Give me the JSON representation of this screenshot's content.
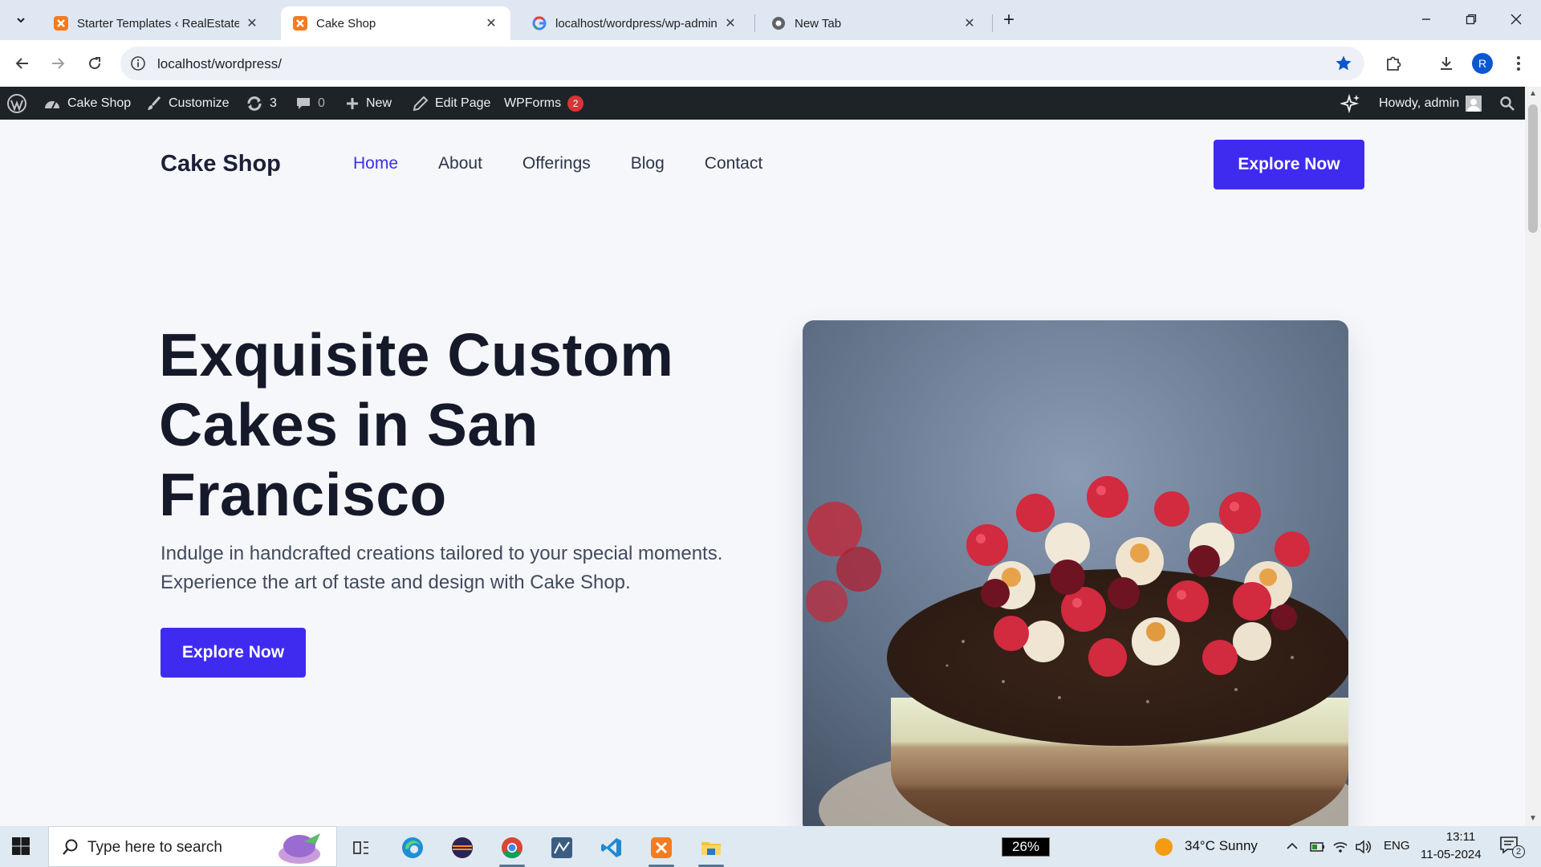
{
  "browser": {
    "tabs": [
      {
        "title": "Starter Templates ‹ RealEstate-E",
        "active": false
      },
      {
        "title": "Cake Shop",
        "active": true
      },
      {
        "title": "localhost/wordpress/wp-admin",
        "active": false
      },
      {
        "title": "New Tab",
        "active": false
      }
    ],
    "url": "localhost/wordpress/",
    "profile_initial": "R"
  },
  "admin_bar": {
    "site_name": "Cake Shop",
    "customize": "Customize",
    "updates_count": "3",
    "comments_count": "0",
    "new": "New",
    "edit_page": "Edit Page",
    "wpforms": "WPForms",
    "wpforms_badge": "2",
    "howdy": "Howdy, admin"
  },
  "site": {
    "title": "Cake Shop",
    "nav": [
      {
        "label": "Home",
        "current": true
      },
      {
        "label": "About",
        "current": false
      },
      {
        "label": "Offerings",
        "current": false
      },
      {
        "label": "Blog",
        "current": false
      },
      {
        "label": "Contact",
        "current": false
      }
    ],
    "header_cta": "Explore Now",
    "hero": {
      "title": "Exquisite Custom Cakes in San Francisco",
      "text": "Indulge in handcrafted creations tailored to your special moments. Experience the art of taste and design with Cake Shop.",
      "cta": "Explore Now"
    },
    "accent_color": "#3f2bf0"
  },
  "taskbar": {
    "search_placeholder": "Type here to search",
    "battery": "26%",
    "weather": "34°C  Sunny",
    "language": "ENG",
    "time": "13:11",
    "date": "11-05-2024",
    "notifications": "2"
  }
}
